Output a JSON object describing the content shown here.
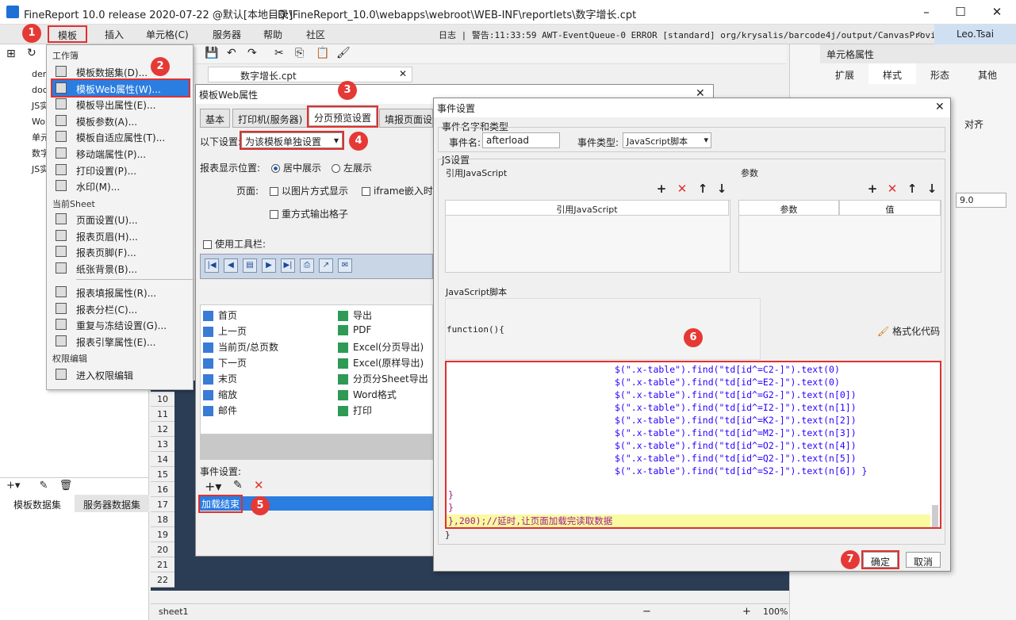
{
  "app": {
    "title": "FineReport 10.0 release 2020-07-22 @默认[本地目录]",
    "path": "D:\\FineReport_10.0\\webapps\\webroot\\WEB-INF\\reportlets\\数字增长.cpt",
    "user": "Leo.Tsai"
  },
  "menu": [
    "文",
    "模板",
    "插入",
    "单元格(C)",
    "服务器",
    "帮助",
    "社区"
  ],
  "log": "日志 | 警告:11:33:59 AWT-EventQueue-0 ERROR [standard] org/krysalis/barcode4j/output/CanvasProvider",
  "left": {
    "tree": [
      "dem",
      "doc",
      "JS实",
      "Wor",
      "单元",
      "数字",
      "JS实"
    ],
    "tabs": [
      "模板数据集",
      "服务器数据集"
    ]
  },
  "doc_tab": "数字增长.cpt",
  "rownums": [
    "10",
    "11",
    "12",
    "13",
    "14",
    "15",
    "16",
    "17",
    "18",
    "19",
    "20",
    "21",
    "22"
  ],
  "sheet": "sheet1",
  "zoom": "100%",
  "right": {
    "title": "单元格属性",
    "tabs": [
      "扩展",
      "样式",
      "形态",
      "其他"
    ],
    "align": "对齐",
    "fontsize": "9.0"
  },
  "dropmenu": {
    "sec1": "工作簿",
    "items1": [
      "模板数据集(D)...",
      "模板Web属性(W)...",
      "模板导出属性(E)...",
      "模板参数(A)...",
      "模板自适应属性(T)...",
      "移动端属性(P)...",
      "打印设置(P)...",
      "水印(M)..."
    ],
    "sec2": "当前Sheet",
    "items2": [
      "页面设置(U)...",
      "报表页眉(H)...",
      "报表页脚(F)...",
      "纸张背景(B)..."
    ],
    "items3": [
      "报表填报属性(R)...",
      "报表分栏(C)...",
      "重复与冻结设置(G)...",
      "报表引擎属性(E)..."
    ],
    "sec3": "权限编辑",
    "items4": [
      "进入权限编辑"
    ]
  },
  "web_dialog": {
    "title": "模板Web属性",
    "tabs": [
      "基本",
      "打印机(服务器)",
      "分页预览设置",
      "填报页面设"
    ],
    "setting_label": "以下设置:",
    "setting_value": "为该模板单独设置",
    "position_label": "报表显示位置:",
    "pos_center": "居中展示",
    "pos_left": "左展示",
    "page_label": "页面:",
    "img_mode": "以图片方式显示",
    "iframe": "iframe嵌入时",
    "redo": "重方式输出格子",
    "toolbar": "使用工具栏:",
    "buttons_left": [
      "首页",
      "上一页",
      "当前页/总页数",
      "下一页",
      "末页",
      "缩放",
      "邮件"
    ],
    "buttons_right": [
      "导出",
      "PDF",
      "Excel(分页导出)",
      "Excel(原样导出)",
      "分页分Sheet导出",
      "Word格式",
      "打印"
    ],
    "event_label": "事件设置:",
    "event_item": "加载结束"
  },
  "event_dialog": {
    "title": "事件设置",
    "sec_name": "事件名字和类型",
    "name_label": "事件名:",
    "name_value": "afterload",
    "type_label": "事件类型:",
    "type_value": "JavaScript脚本",
    "js_sec": "JS设置",
    "ref_js": "引用JavaScript",
    "params": "参数",
    "col_ref": "引用JavaScript",
    "col_param": "参数",
    "col_value": "值",
    "script_label": "JavaScript脚本",
    "func_head": "function(){",
    "format": "格式化代码",
    "code": [
      "$(\".x-table\").find(\"td[id^=C2-]\").text(0)",
      "$(\".x-table\").find(\"td[id^=E2-]\").text(0)",
      "$(\".x-table\").find(\"td[id^=G2-]\").text(n[0])",
      "$(\".x-table\").find(\"td[id^=I2-]\").text(n[1])",
      "$(\".x-table\").find(\"td[id^=K2-]\").text(n[2])",
      "$(\".x-table\").find(\"td[id^=M2-]\").text(n[3])",
      "$(\".x-table\").find(\"td[id^=O2-]\").text(n[4])",
      "$(\".x-table\").find(\"td[id^=Q2-]\").text(n[5])",
      "$(\".x-table\").find(\"td[id^=S2-]\").text(n[6]) }"
    ],
    "close1": "}",
    "close2": "}",
    "tail": "},200);//延时,让页面加载完读取数据",
    "end": "}",
    "ok": "确定",
    "cancel": "取消"
  },
  "badges": [
    "1",
    "2",
    "3",
    "4",
    "5",
    "6",
    "7"
  ]
}
